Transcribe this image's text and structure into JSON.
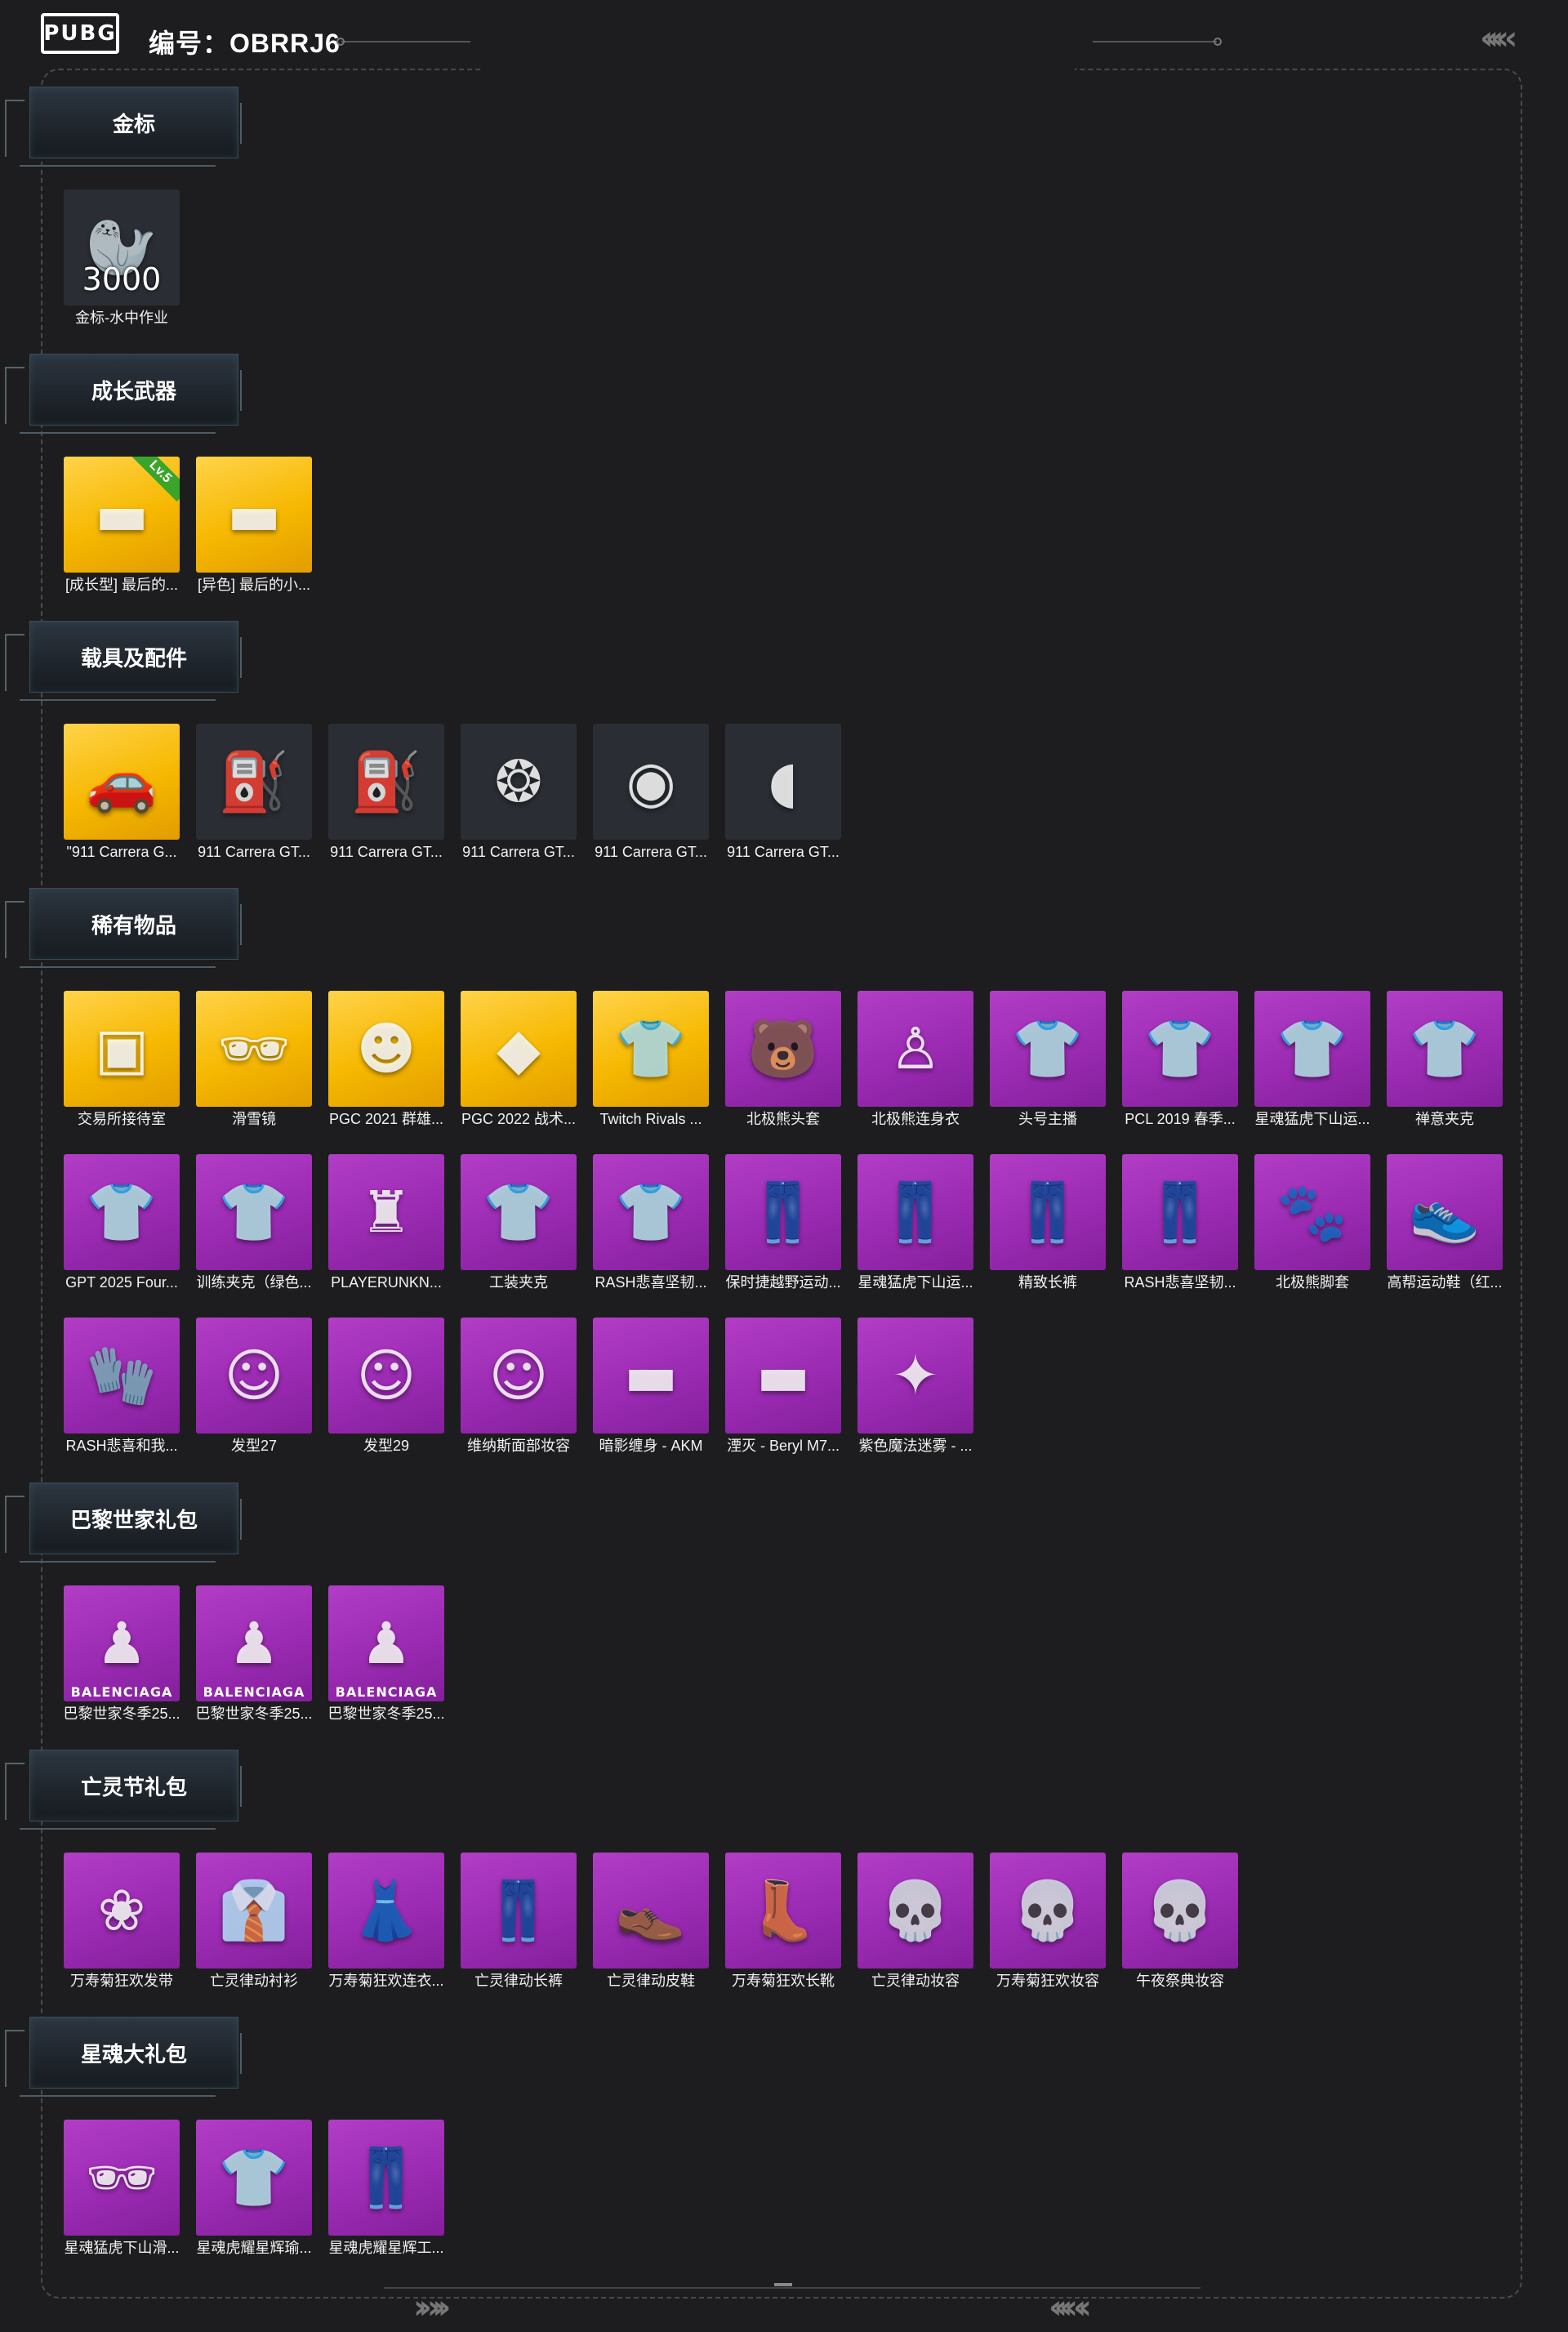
{
  "header": {
    "code_label": "编号：OBRRJ6"
  },
  "sections": [
    {
      "title": "金标",
      "items": [
        {
          "name": "金标-水中作业",
          "bg": "dark",
          "icon": "sea-lion-emblem-icon",
          "glyph": "🦭",
          "number": "3000"
        }
      ]
    },
    {
      "title": "成长武器",
      "items": [
        {
          "name": "[成长型] 最后的...",
          "bg": "gold",
          "icon": "rifle-icon",
          "glyph": "▬",
          "level": "Lv.5"
        },
        {
          "name": "[异色] 最后的小...",
          "bg": "gold",
          "icon": "rifle-icon",
          "glyph": "▬"
        }
      ]
    },
    {
      "title": "载具及配件",
      "items": [
        {
          "name": "\"911 Carrera G...",
          "bg": "gold",
          "icon": "car-icon",
          "glyph": "🚗"
        },
        {
          "name": "911 Carrera GT...",
          "bg": "dark",
          "icon": "spray-gun-icon",
          "glyph": "⛽"
        },
        {
          "name": "911 Carrera GT...",
          "bg": "dark",
          "icon": "spray-gun-icon",
          "glyph": "⛽"
        },
        {
          "name": "911 Carrera GT...",
          "bg": "dark",
          "icon": "wheel-icon",
          "glyph": "❂"
        },
        {
          "name": "911 Carrera GT...",
          "bg": "dark",
          "icon": "wheel-icon",
          "glyph": "◉"
        },
        {
          "name": "911 Carrera GT...",
          "bg": "dark",
          "icon": "side-mirror-icon",
          "glyph": "◖"
        }
      ]
    },
    {
      "title": "稀有物品",
      "items": [
        {
          "name": "交易所接待室",
          "bg": "gold",
          "icon": "room-icon",
          "glyph": "▣"
        },
        {
          "name": "滑雪镜",
          "bg": "gold",
          "icon": "goggles-icon",
          "glyph": "🕶"
        },
        {
          "name": "PGC 2021 群雄...",
          "bg": "gold",
          "icon": "mask-icon",
          "glyph": "☻"
        },
        {
          "name": "PGC 2022 战术...",
          "bg": "gold",
          "icon": "vest-icon",
          "glyph": "◆"
        },
        {
          "name": "Twitch Rivals ...",
          "bg": "gold",
          "icon": "jacket-icon",
          "glyph": "👕"
        },
        {
          "name": "北极熊头套",
          "bg": "purple",
          "icon": "bear-head-icon",
          "glyph": "🐻"
        },
        {
          "name": "北极熊连身衣",
          "bg": "purple",
          "icon": "bodysuit-icon",
          "glyph": "♙"
        },
        {
          "name": "头号主播",
          "bg": "purple",
          "icon": "tshirt-icon",
          "glyph": "👕"
        },
        {
          "name": "PCL 2019 春季...",
          "bg": "purple",
          "icon": "jacket-icon",
          "glyph": "👕"
        },
        {
          "name": "星魂猛虎下山运...",
          "bg": "purple",
          "icon": "jacket-icon",
          "glyph": "👕"
        },
        {
          "name": "禅意夹克",
          "bg": "purple",
          "icon": "hoodie-icon",
          "glyph": "👕"
        },
        {
          "name": "GPT 2025 Four...",
          "bg": "purple",
          "icon": "hoodie-icon",
          "glyph": "👕"
        },
        {
          "name": "训练夹克（绿色...",
          "bg": "purple",
          "icon": "jacket-icon",
          "glyph": "👕"
        },
        {
          "name": "PLAYERUNKN...",
          "bg": "purple",
          "icon": "coat-icon",
          "glyph": "♜"
        },
        {
          "name": "工装夹克",
          "bg": "purple",
          "icon": "jacket-icon",
          "glyph": "👕"
        },
        {
          "name": "RASH悲喜坚韧...",
          "bg": "purple",
          "icon": "hoodie-icon",
          "glyph": "👕"
        },
        {
          "name": "保时捷越野运动...",
          "bg": "purple",
          "icon": "pants-icon",
          "glyph": "👖"
        },
        {
          "name": "星魂猛虎下山运...",
          "bg": "purple",
          "icon": "pants-icon",
          "glyph": "👖"
        },
        {
          "name": "精致长裤",
          "bg": "purple",
          "icon": "pants-icon",
          "glyph": "👖"
        },
        {
          "name": "RASH悲喜坚韧...",
          "bg": "purple",
          "icon": "pants-icon",
          "glyph": "👖"
        },
        {
          "name": "北极熊脚套",
          "bg": "purple",
          "icon": "paw-icon",
          "glyph": "🐾"
        },
        {
          "name": "高帮运动鞋（红...",
          "bg": "purple",
          "icon": "shoes-icon",
          "glyph": "👟"
        },
        {
          "name": "RASH悲喜和我...",
          "bg": "purple",
          "icon": "gloves-icon",
          "glyph": "🧤"
        },
        {
          "name": "发型27",
          "bg": "purple",
          "icon": "hairstyle-icon",
          "glyph": "☺"
        },
        {
          "name": "发型29",
          "bg": "purple",
          "icon": "hairstyle-icon",
          "glyph": "☺"
        },
        {
          "name": "维纳斯面部妆容",
          "bg": "purple",
          "icon": "face-icon",
          "glyph": "☺"
        },
        {
          "name": "暗影缠身 - AKM",
          "bg": "purple",
          "icon": "rifle-icon",
          "glyph": "▬"
        },
        {
          "name": "湮灭 - Beryl M7...",
          "bg": "purple",
          "icon": "rifle-icon",
          "glyph": "▬"
        },
        {
          "name": "紫色魔法迷雾 - ...",
          "bg": "purple",
          "icon": "gun-icon",
          "glyph": "✦"
        }
      ]
    },
    {
      "title": "巴黎世家礼包",
      "items": [
        {
          "name": "巴黎世家冬季25...",
          "bg": "purple",
          "icon": "outfit-icon",
          "glyph": "♟",
          "brand": "BALENCIAGA"
        },
        {
          "name": "巴黎世家冬季25...",
          "bg": "purple",
          "icon": "outfit-icon",
          "glyph": "♟",
          "brand": "BALENCIAGA"
        },
        {
          "name": "巴黎世家冬季25...",
          "bg": "purple",
          "icon": "outfit-icon",
          "glyph": "♟",
          "brand": "BALENCIAGA"
        }
      ]
    },
    {
      "title": "亡灵节礼包",
      "items": [
        {
          "name": "万寿菊狂欢发带",
          "bg": "purple",
          "icon": "headband-icon",
          "glyph": "❀"
        },
        {
          "name": "亡灵律动衬衫",
          "bg": "purple",
          "icon": "shirt-icon",
          "glyph": "👔"
        },
        {
          "name": "万寿菊狂欢连衣...",
          "bg": "purple",
          "icon": "dress-icon",
          "glyph": "👗"
        },
        {
          "name": "亡灵律动长裤",
          "bg": "purple",
          "icon": "pants-icon",
          "glyph": "👖"
        },
        {
          "name": "亡灵律动皮鞋",
          "bg": "purple",
          "icon": "shoes-icon",
          "glyph": "👞"
        },
        {
          "name": "万寿菊狂欢长靴",
          "bg": "purple",
          "icon": "boots-icon",
          "glyph": "👢"
        },
        {
          "name": "亡灵律动妆容",
          "bg": "purple",
          "icon": "skull-face-icon",
          "glyph": "💀"
        },
        {
          "name": "万寿菊狂欢妆容",
          "bg": "purple",
          "icon": "skull-face-icon",
          "glyph": "💀"
        },
        {
          "name": "午夜祭典妆容",
          "bg": "purple",
          "icon": "skull-face-icon",
          "glyph": "💀"
        }
      ]
    },
    {
      "title": "星魂大礼包",
      "items": [
        {
          "name": "星魂猛虎下山滑...",
          "bg": "purple",
          "icon": "goggles-icon",
          "glyph": "🕶"
        },
        {
          "name": "星魂虎耀星辉瑜...",
          "bg": "purple",
          "icon": "jacket-icon",
          "glyph": "👕"
        },
        {
          "name": "星魂虎耀星辉工...",
          "bg": "purple",
          "icon": "pants-icon",
          "glyph": "👖"
        }
      ]
    }
  ]
}
